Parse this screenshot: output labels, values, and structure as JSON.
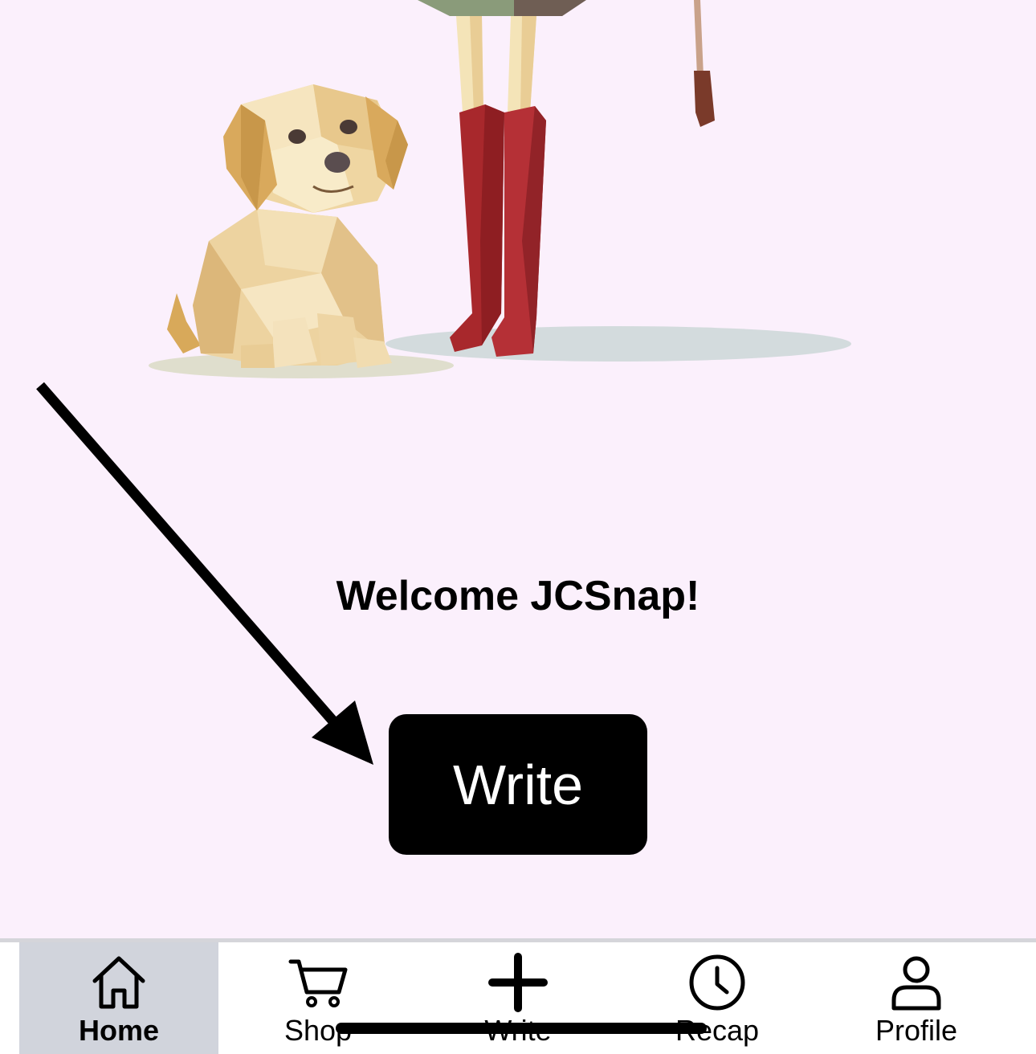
{
  "welcome": {
    "text": "Welcome JCSnap!"
  },
  "main": {
    "write_button_label": "Write"
  },
  "tabbar": {
    "items": [
      {
        "label": "Home",
        "icon": "house-icon",
        "active": true
      },
      {
        "label": "Shop",
        "icon": "cart-icon",
        "active": false
      },
      {
        "label": "Write",
        "icon": "plus-icon",
        "active": false
      },
      {
        "label": "Recap",
        "icon": "clock-icon",
        "active": false
      },
      {
        "label": "Profile",
        "icon": "person-icon",
        "active": false
      }
    ]
  },
  "colors": {
    "background": "#fbf0fc",
    "button": "#000000",
    "button_text": "#ffffff",
    "active_tab": "#d1d4dc",
    "boots": "#a8282c",
    "dog": "#e8c98a"
  }
}
